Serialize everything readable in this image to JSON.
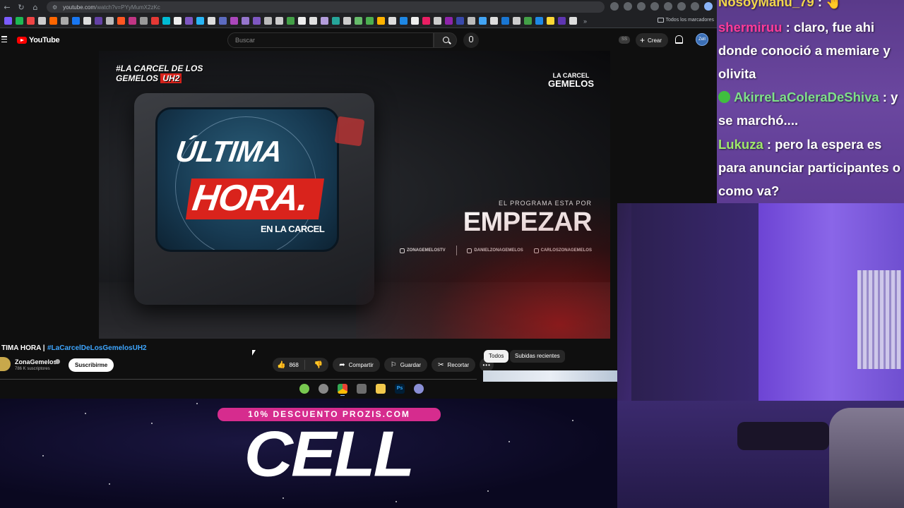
{
  "browser": {
    "url_host": "youtube.com",
    "url_path": "/watch?v=PYyMumX2zKc",
    "bookmarks_all_label": "Todos los marcadores"
  },
  "youtube": {
    "logo_text": "YouTube",
    "search_placeholder": "Buscar",
    "ss_badge": "SS",
    "create_label": "Crear",
    "avatar_text": "Zell"
  },
  "video": {
    "brand_left_line1": "#LA CARCEL DE LOS",
    "brand_left_line2": "GEMELOS",
    "brand_left_tag": "UH2",
    "brand_right_line1": "LA CARCEL",
    "brand_right_line2": "GEMELOS",
    "screen_line1": "ÚLTIMA",
    "screen_line2": "HORA.",
    "screen_line3": "EN LA CARCEL",
    "program_small": "EL PROGRAMA ESTA POR",
    "program_big": "EMPEZAR",
    "socials": [
      "ZONAGEMELOSTV",
      "DANIELZONAGEMELOS",
      "CARLOSZONAGEMELOS"
    ]
  },
  "watch": {
    "title_prefix": "TIMA HORA |",
    "title_hashtag": "#LaCarcelDeLosGemelosUH2",
    "channel_name": "ZonaGemelos",
    "subscribers": "786 K suscriptores",
    "subscribe_label": "Suscribirme",
    "like_count": "868",
    "share_label": "Compartir",
    "save_label": "Guardar",
    "clip_label": "Recortar",
    "chips": [
      "Todos",
      "Subidas recientes"
    ]
  },
  "promo": {
    "banner": "10% DESCUENTO PROZIS.COM",
    "code": "CELL"
  },
  "chat": {
    "messages": [
      {
        "user": "NosoyManu_79",
        "text": ": 🤚"
      },
      {
        "user": "shermiruu",
        "text": ": claro, fue ahi donde conoció a memiare y olivita"
      },
      {
        "user": "AkirreLaColeraDeShiva",
        "text": ": y se marchó...."
      },
      {
        "user": "Lukuza",
        "text": ": pero la espera es para anunciar participantes o como va?"
      }
    ],
    "colors": {
      "user1": "#f2d64b",
      "user2": "#ff3b9a",
      "user3": "#7fe08a",
      "user4": "#9fe86a"
    }
  },
  "taskbar": {
    "ps_label": "Ps"
  }
}
